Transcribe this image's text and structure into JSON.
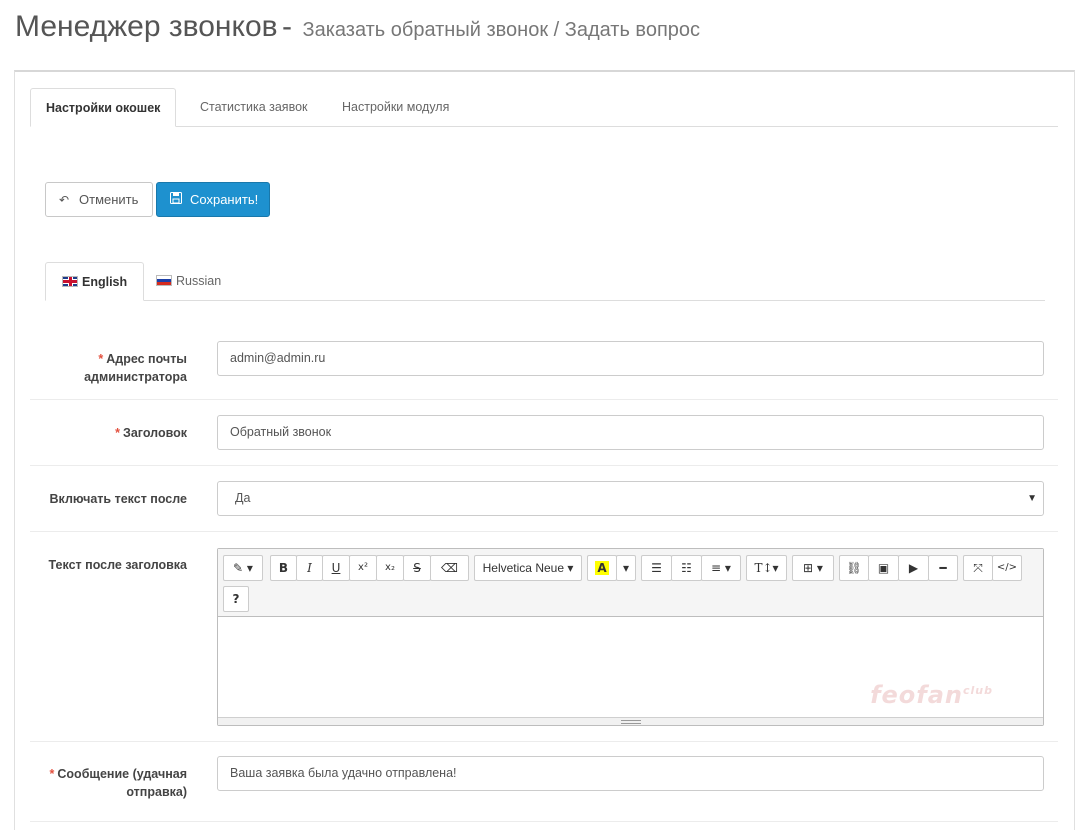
{
  "header": {
    "title": "Менеджер звонков",
    "separator": "-",
    "subtitle": "Заказать обратный звонок / Задать вопрос"
  },
  "tabs": [
    {
      "label": "Настройки окошек",
      "active": true
    },
    {
      "label": "Статистика заявок",
      "active": false
    },
    {
      "label": "Настройки модуля",
      "active": false
    }
  ],
  "buttons": {
    "cancel": "Отменить",
    "save": "Сохранить!"
  },
  "lang_tabs": [
    {
      "label": "English",
      "active": true
    },
    {
      "label": "Russian",
      "active": false
    }
  ],
  "form": {
    "admin_email": {
      "label": "Адрес почты администратора",
      "required": true,
      "value": "admin@admin.ru"
    },
    "heading": {
      "label": "Заголовок",
      "required": true,
      "value": "Обратный звонок"
    },
    "include_text": {
      "label": "Включать текст после",
      "value": "Да"
    },
    "text_after": {
      "label": "Текст после заголовка"
    },
    "message": {
      "label": "Сообщение (удачная отправка)",
      "required": true,
      "value": "Ваша заявка была удачно отправлена!"
    }
  },
  "editor": {
    "font_name": "Helvetica Neue",
    "tools": [
      "magic",
      "bold",
      "italic",
      "underline",
      "superscript",
      "subscript",
      "strikethrough",
      "eraser",
      "font-name",
      "color",
      "ul",
      "ol",
      "paragraph",
      "line-height",
      "table",
      "link",
      "picture",
      "video",
      "hr",
      "fullscreen",
      "codeview",
      "help"
    ]
  },
  "watermark": {
    "text": "feofan",
    "sup": "club"
  },
  "colors": {
    "primary": "#1e91cf",
    "required": "#e3503e"
  }
}
